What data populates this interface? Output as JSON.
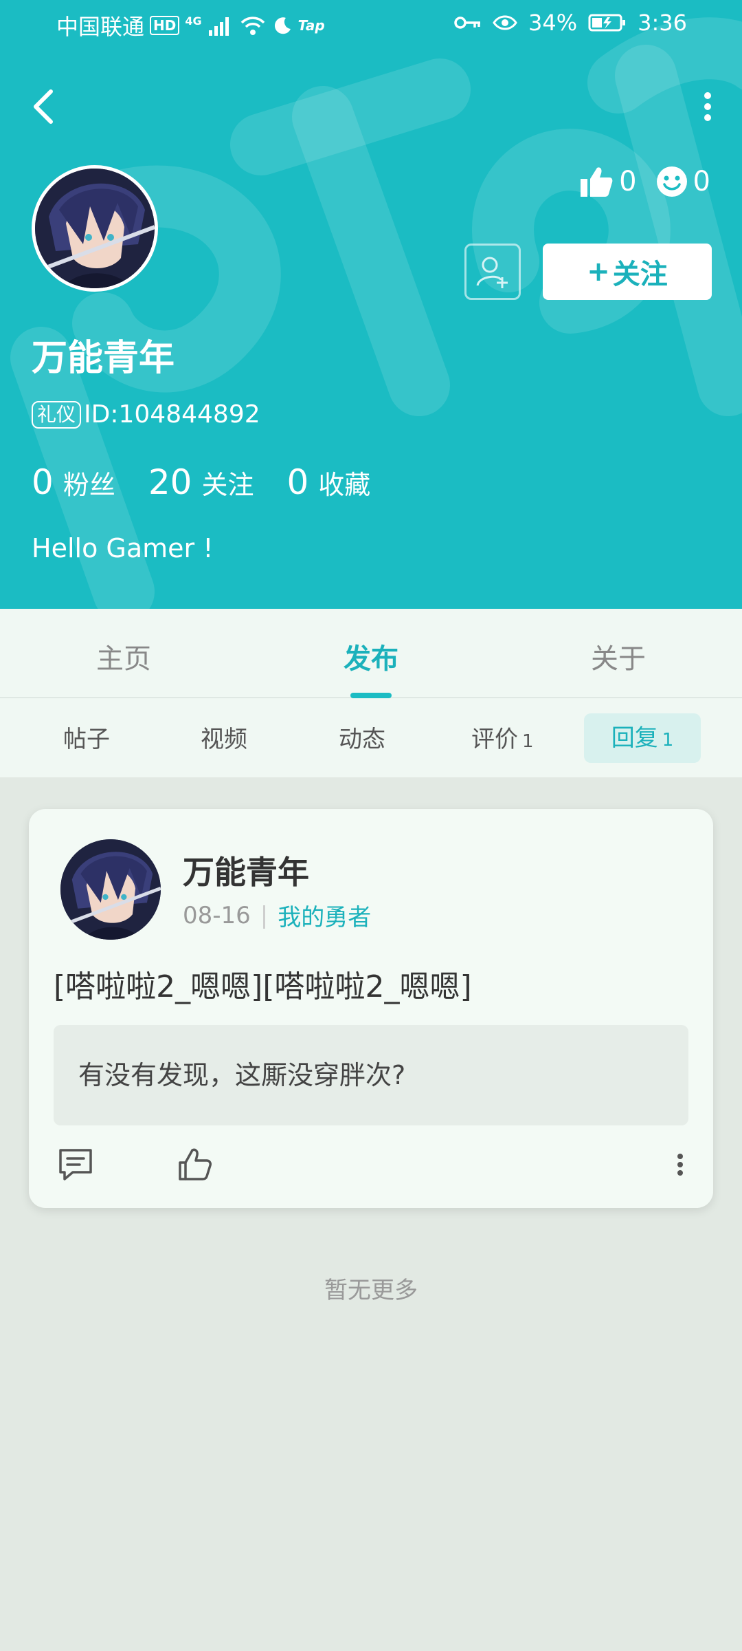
{
  "status_bar": {
    "carrier": "中国联通",
    "hd": "HD",
    "network": "4G",
    "tap_label": "Tap",
    "battery": "34%",
    "time": "3:36"
  },
  "profile": {
    "username": "万能青年",
    "tag": "礼仪",
    "id_text": "ID:104844892",
    "likes": "0",
    "smiles": "0",
    "follow_label": "关注",
    "follow_plus": "+",
    "fans_count": "0",
    "fans_label": "粉丝",
    "following_count": "20",
    "following_label": "关注",
    "favorites_count": "0",
    "favorites_label": "收藏",
    "bio": "Hello Gamer !"
  },
  "tabs": [
    {
      "label": "主页"
    },
    {
      "label": "发布"
    },
    {
      "label": "关于"
    }
  ],
  "active_tab": "发布",
  "subtabs": [
    {
      "label": "帖子",
      "count": ""
    },
    {
      "label": "视频",
      "count": ""
    },
    {
      "label": "动态",
      "count": ""
    },
    {
      "label": "评价",
      "count": "1"
    },
    {
      "label": "回复",
      "count": "1"
    }
  ],
  "active_subtab": "回复",
  "post": {
    "author": "万能青年",
    "date": "08-16",
    "game": "我的勇者",
    "content": "[嗒啦啦2_嗯嗯][嗒啦啦2_嗯嗯]",
    "quote": "有没有发现，这厮没穿胖次?"
  },
  "footer_text": "暂无更多",
  "colors": {
    "accent": "#1bbcc3",
    "accent_text": "#1bb1bb",
    "background": "#e2e9e3",
    "card": "#f3faf5"
  },
  "icons": [
    "back-icon",
    "more-vertical-icon",
    "thumbs-up-icon",
    "smile-icon",
    "add-user-icon",
    "comment-icon",
    "like-icon",
    "more-dots-icon",
    "wifi-icon",
    "signal-icon",
    "key-icon",
    "eye-icon",
    "battery-icon",
    "moon-icon"
  ]
}
